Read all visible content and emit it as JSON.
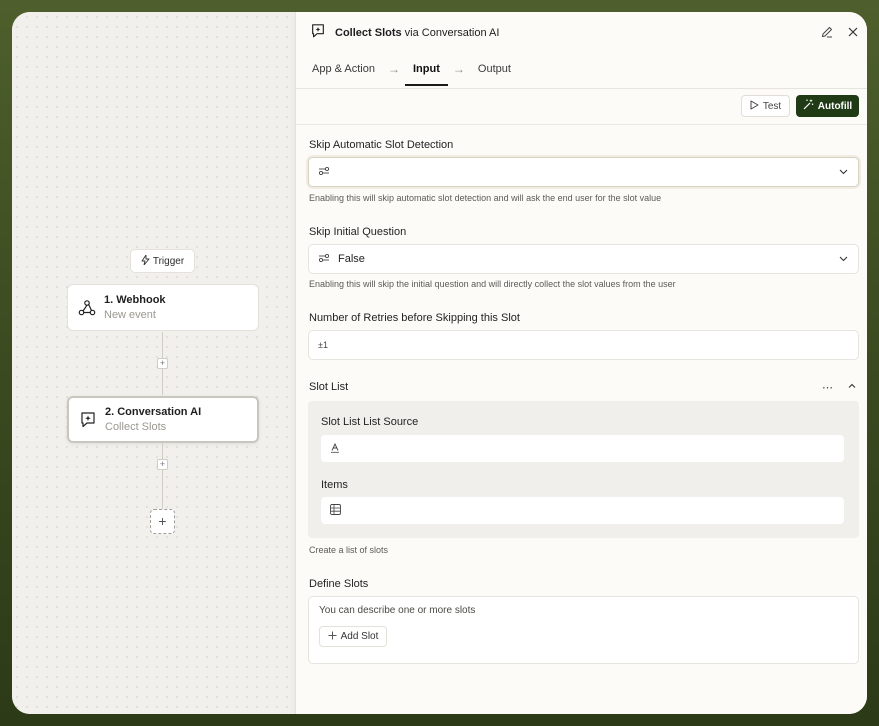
{
  "canvas": {
    "trigger_label": "Trigger",
    "nodes": [
      {
        "title": "1. Webhook",
        "subtitle": "New event",
        "icon": "webhook-icon"
      },
      {
        "title": "2. Conversation AI",
        "subtitle": "Collect Slots",
        "icon": "conversation-ai-icon"
      }
    ],
    "add_step_symbol": "+"
  },
  "panel": {
    "title_bold": "Collect Slots",
    "title_rest": " via Conversation AI",
    "tabs": [
      {
        "label": "App & Action",
        "active": false
      },
      {
        "label": "Input",
        "active": true
      },
      {
        "label": "Output",
        "active": false
      }
    ],
    "test_label": "Test",
    "autofill_label": "Autofill",
    "fields": {
      "skip_detection": {
        "label": "Skip Automatic Slot Detection",
        "value": "",
        "help": "Enabling this will skip automatic slot detection and will ask the end user for the slot value"
      },
      "skip_initial": {
        "label": "Skip Initial Question",
        "value": "False",
        "help": "Enabling this will skip the initial question and will directly collect the slot values from the user"
      },
      "retries": {
        "label": "Number of Retries before Skipping this Slot",
        "value": "",
        "icon_text": "±1"
      },
      "slot_list": {
        "label": "Slot List",
        "source_label": "Slot List List Source",
        "items_label": "Items",
        "help": "Create a list of slots"
      },
      "define_slots": {
        "label": "Define Slots",
        "description": "You can describe one or more slots",
        "add_label": "Add Slot"
      }
    }
  },
  "colors": {
    "accent": "#1f3a14",
    "frame": "#3b4a20"
  }
}
